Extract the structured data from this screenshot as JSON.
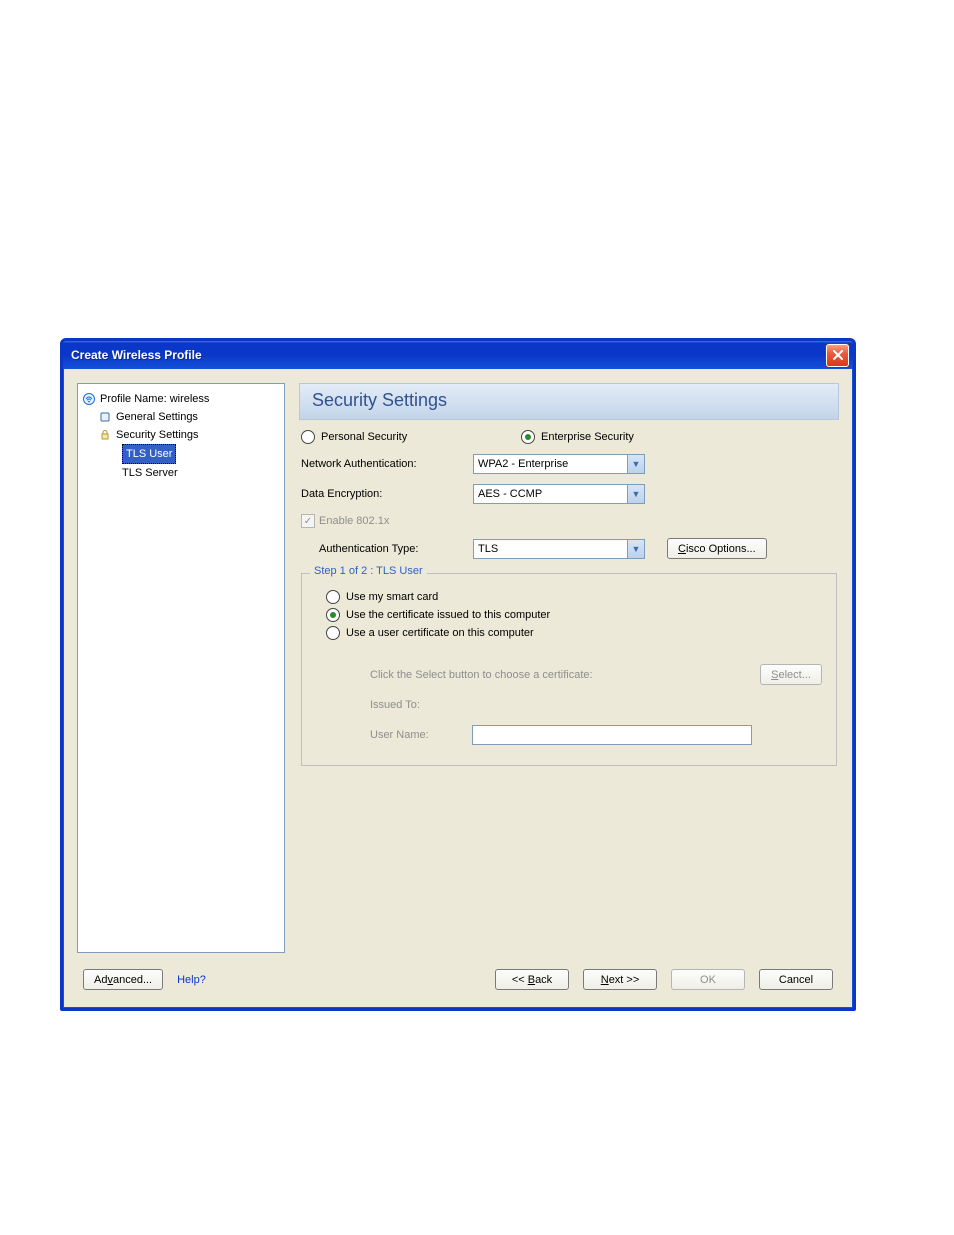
{
  "window": {
    "title": "Create Wireless Profile"
  },
  "tree": {
    "profile": "Profile Name: wireless",
    "general": "General Settings",
    "security": "Security Settings",
    "tls_user": "TLS User",
    "tls_server": "TLS Server"
  },
  "panel": {
    "header": "Security Settings",
    "radio_personal": "Personal Security",
    "radio_enterprise": "Enterprise Security",
    "net_auth_label": "Network Authentication:",
    "net_auth_value": "WPA2 - Enterprise",
    "data_enc_label": "Data Encryption:",
    "data_enc_value": "AES - CCMP",
    "enable_8021x": "Enable 802.1x",
    "auth_type_label": "Authentication Type:",
    "auth_type_value": "TLS",
    "cisco_btn": "Cisco Options...",
    "group_legend": "Step 1 of 2 : TLS User",
    "opt_smart": "Use my smart card",
    "opt_cert_computer": "Use the certificate issued to this computer",
    "opt_user_cert": "Use a user certificate on this computer",
    "hint": "Click the Select button to choose a certificate:",
    "select_btn": "Select...",
    "issued_to": "Issued To:",
    "user_name": "User Name:"
  },
  "buttons": {
    "advanced": "Advanced...",
    "help": "Help?",
    "back": "<< Back",
    "next": "Next >>",
    "ok": "OK",
    "cancel": "Cancel"
  }
}
